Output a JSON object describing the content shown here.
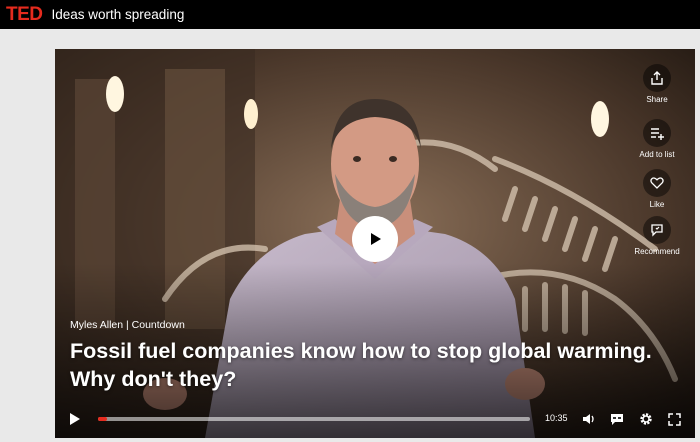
{
  "header": {
    "logo": "TED",
    "tagline": "Ideas worth spreading"
  },
  "video": {
    "speaker": "Myles Allen | Countdown",
    "title_line1": "Fossil fuel companies know how to stop global warming.",
    "title_line2": "Why don't they?",
    "duration": "10:35",
    "progress_fraction": 0.01
  },
  "actions": {
    "share": "Share",
    "add_to_list": "Add to list",
    "like": "Like",
    "recommend": "Recommend"
  },
  "colors": {
    "brand": "#e62b1e",
    "topbar": "#000000",
    "page_bg": "#e9e9e9"
  }
}
